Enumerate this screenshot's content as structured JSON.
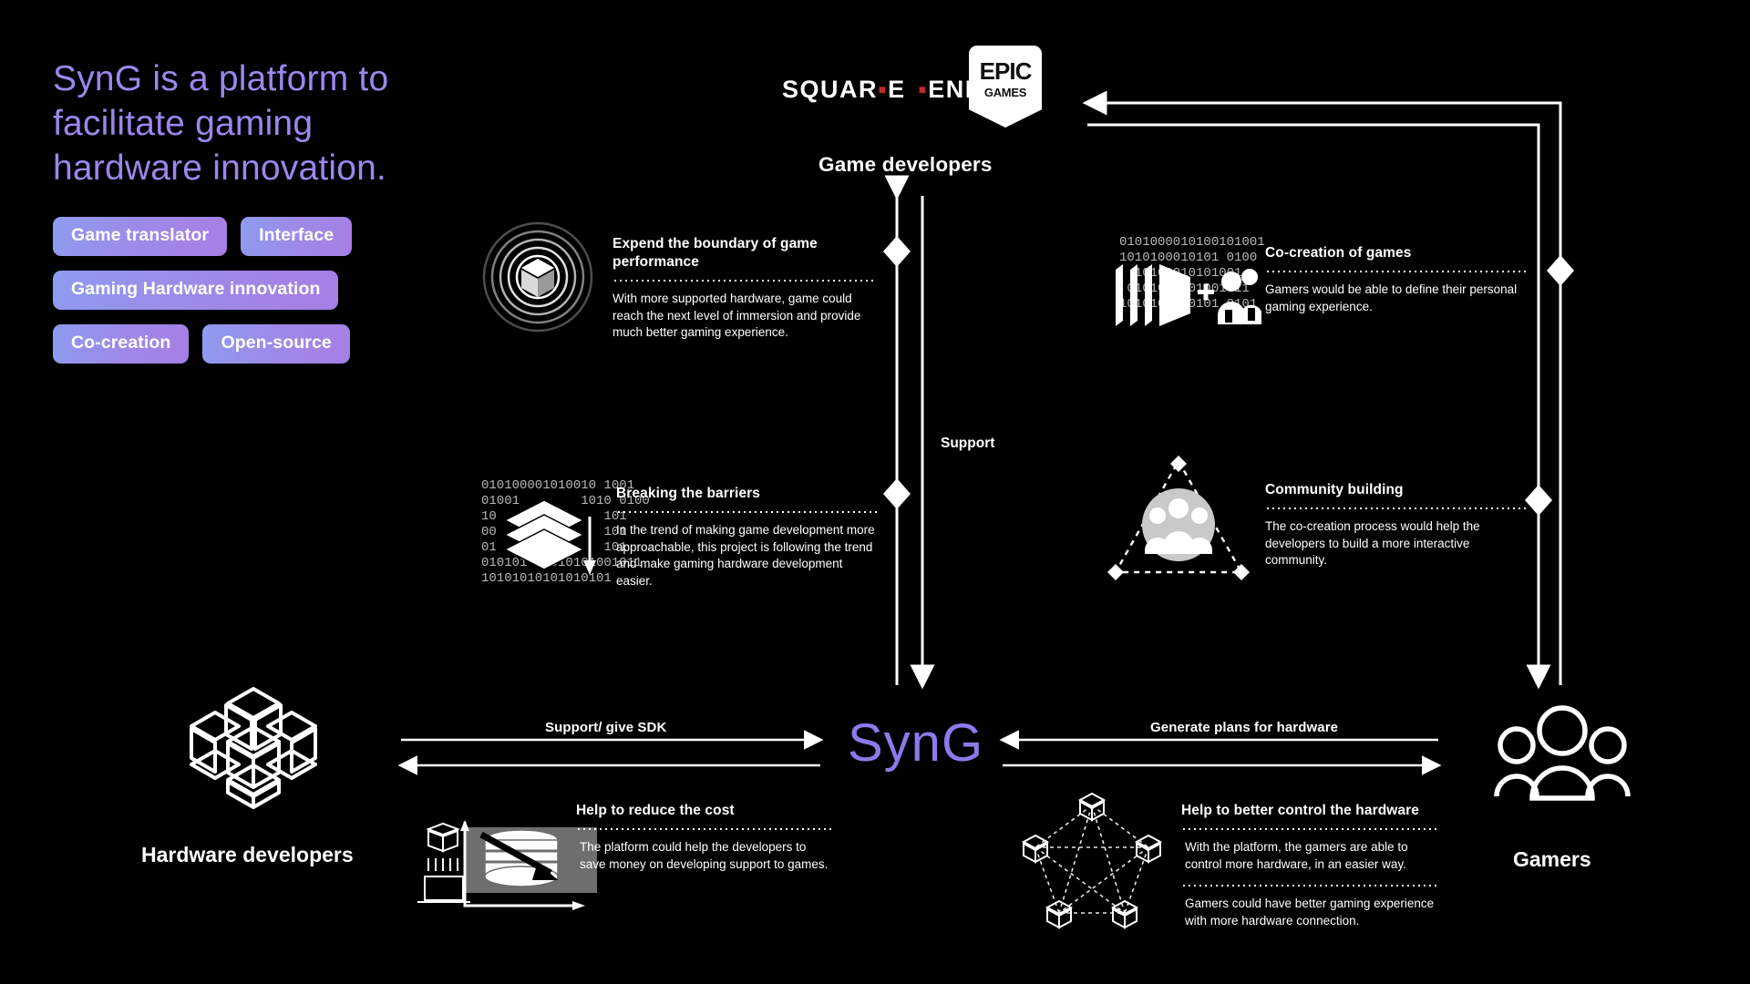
{
  "headline": "SynG is a platform to facilitate gaming hardware innovation.",
  "pills": [
    [
      "Game translator",
      "Interface"
    ],
    [
      "Gaming Hardware innovation"
    ],
    [
      "Co-creation",
      "Open-source"
    ]
  ],
  "logos": {
    "square_enix_part1": "SQUAR",
    "square_enix_dash": "▪",
    "square_enix_part2": "Е ЕNIX",
    "square_enix_full": "SQUARE ENIX",
    "epic_line1": "EPIC",
    "epic_line2": "GAMES"
  },
  "nodes": {
    "game_developers": "Game developers",
    "hardware_developers": "Hardware developers",
    "gamers": "Gamers",
    "platform": "SynG"
  },
  "arrow_labels": {
    "support_sdk": "Support/ give SDK",
    "generate_plans": "Generate plans for hardware",
    "support": "Support"
  },
  "cards": {
    "expend": {
      "title": "Expend the boundary of game performance",
      "body": "With more supported hardware, game could reach the next level of immersion and provide much better gaming experience."
    },
    "breaking": {
      "title": "Breaking the barriers",
      "body": "In the trend of making game development more approachable, this project is following the trend and make gaming hardware development easier."
    },
    "cocreation": {
      "title": "Co-creation of games",
      "body": "Gamers would be able to define their personal gaming experience."
    },
    "community": {
      "title": "Community building",
      "body": "The co-creation process would help the developers to build a more interactive community."
    },
    "cost": {
      "title": "Help to reduce the cost",
      "body": "The platform could help the developers to save money on developing support to games."
    },
    "control": {
      "title": "Help to better control the hardware",
      "body1": "With the platform, the gamers are able to control more hardware, in an easier way.",
      "body2": "Gamers could have better gaming experience with more hardware connection."
    }
  },
  "binary_art": {
    "right": "0101000010100101001\n1010100010101 0100\n  10101010101001\n 0101010101001011\n1010101010101 0101",
    "left": "010100001010010 1001\n01001        1010 0100\n10              101\n00              101\n01              101\n010101   010101001011\n10101010101010101"
  },
  "colors": {
    "background": "#000000",
    "accent_purple": "#8b7aeb",
    "headline_purple": "#9b87ec",
    "pill_gradient_start": "#8e9bf0",
    "pill_gradient_end": "#a77ee4",
    "line_white": "#ffffff",
    "square_enix_red": "#c1272d"
  }
}
